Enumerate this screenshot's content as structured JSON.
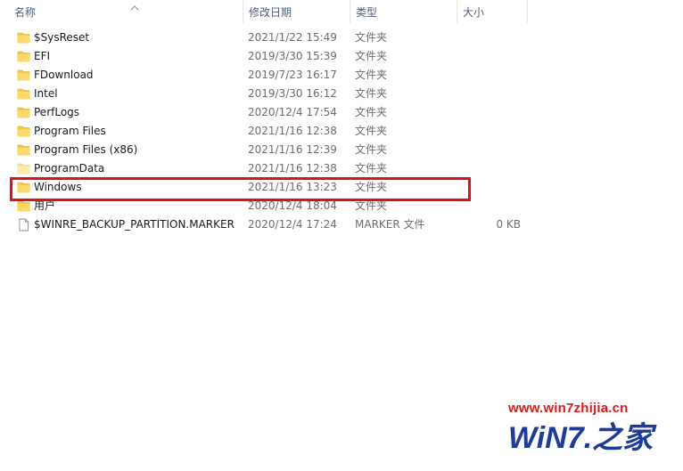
{
  "columns": {
    "name": "名称",
    "date": "修改日期",
    "type": "类型",
    "size": "大小"
  },
  "rows": [
    {
      "name": "$SysReset",
      "date": "2021/1/22 15:49",
      "type": "文件夹",
      "size": "",
      "icon": "folder-icon"
    },
    {
      "name": "EFI",
      "date": "2019/3/30 15:39",
      "type": "文件夹",
      "size": "",
      "icon": "folder-icon"
    },
    {
      "name": "FDownload",
      "date": "2019/7/23 16:17",
      "type": "文件夹",
      "size": "",
      "icon": "folder-icon"
    },
    {
      "name": "Intel",
      "date": "2019/3/30 16:12",
      "type": "文件夹",
      "size": "",
      "icon": "folder-icon"
    },
    {
      "name": "PerfLogs",
      "date": "2020/12/4 17:54",
      "type": "文件夹",
      "size": "",
      "icon": "folder-icon"
    },
    {
      "name": "Program Files",
      "date": "2021/1/16 12:38",
      "type": "文件夹",
      "size": "",
      "icon": "folder-icon"
    },
    {
      "name": "Program Files (x86)",
      "date": "2021/1/16 12:39",
      "type": "文件夹",
      "size": "",
      "icon": "folder-icon"
    },
    {
      "name": "ProgramData",
      "date": "2021/1/16 12:38",
      "type": "文件夹",
      "size": "",
      "icon": "folder-icon"
    },
    {
      "name": "Windows",
      "date": "2021/1/16 13:23",
      "type": "文件夹",
      "size": "",
      "icon": "folder-icon"
    },
    {
      "name": "用户",
      "date": "2020/12/4 18:04",
      "type": "文件夹",
      "size": "",
      "icon": "folder-icon"
    },
    {
      "name": "$WINRE_BACKUP_PARTITION.MARKER",
      "date": "2020/12/4 17:24",
      "type": "MARKER 文件",
      "size": "0 KB",
      "icon": "file-icon"
    }
  ],
  "watermark": {
    "url": "www.win7zhijia.cn",
    "logo": "WiN7.之家"
  },
  "colors": {
    "highlight": "#e3101a",
    "folder": "#f5c94a",
    "header_text": "#4c607a",
    "watermark_red": "#e01818",
    "watermark_blue": "#1b3c9a"
  }
}
